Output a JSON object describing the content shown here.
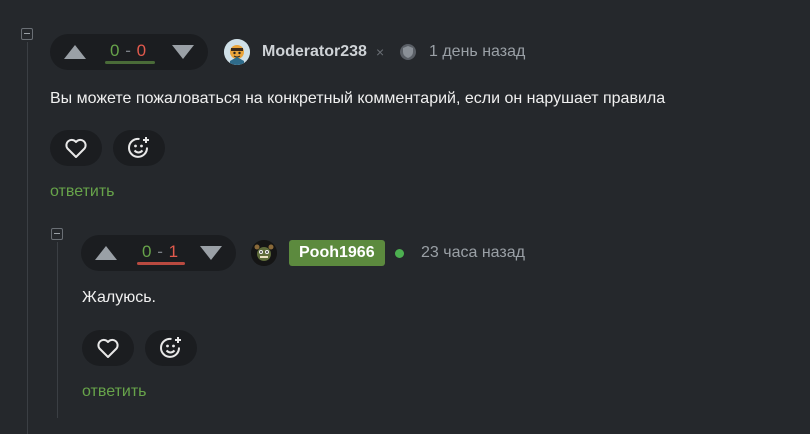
{
  "comments": [
    {
      "rating": {
        "plus": "0",
        "separator": "-",
        "minus": "0"
      },
      "author": "Moderator238",
      "mod_mark": "×",
      "time": "1 день назад",
      "text": "Вы можете пожаловаться на конкретный комментарий, если он нарушает правила",
      "reply_label": "ответить",
      "icons": {
        "like": "heart-icon",
        "react": "emoji-add-icon",
        "badge": "moderator-shield-icon"
      }
    },
    {
      "rating": {
        "plus": "0",
        "separator": "-",
        "minus": "1"
      },
      "author": "Pooh1966",
      "time": "23 часа назад",
      "text": "Жалуюсь.",
      "reply_label": "ответить",
      "icons": {
        "like": "heart-icon",
        "react": "emoji-add-icon",
        "online": "online-dot"
      }
    }
  ],
  "colors": {
    "background": "#25282c",
    "positive": "#67a34a",
    "negative": "#e25a4d",
    "author_badge": "#5c8a3e"
  }
}
